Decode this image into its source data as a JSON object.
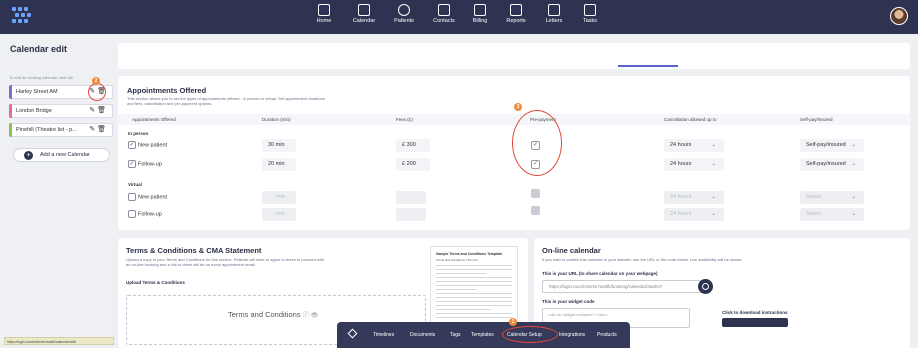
{
  "nav": {
    "items": [
      {
        "label": "Home",
        "icon": "home-icon"
      },
      {
        "label": "Calendar",
        "icon": "calendar-icon"
      },
      {
        "label": "Patients",
        "icon": "patients-icon"
      },
      {
        "label": "Contacts",
        "icon": "contacts-icon"
      },
      {
        "label": "Billing",
        "icon": "billing-icon"
      },
      {
        "label": "Reports",
        "icon": "reports-icon"
      },
      {
        "label": "Letters",
        "icon": "letters-icon"
      },
      {
        "label": "Tasks",
        "icon": "tasks-icon"
      }
    ]
  },
  "page_title": "Calendar edit",
  "sidebar": {
    "hint": "To edit an existing calendar click the",
    "calendars": [
      {
        "name": "Harley Street AM",
        "color": "#7b6fd6"
      },
      {
        "name": "London Bridge",
        "color": "#e36a9b"
      },
      {
        "name": "Pinehill (Theatre list - p...",
        "color": "#8bc34a"
      }
    ],
    "add_label": "Add a new Calendar"
  },
  "appointments": {
    "title": "Appointments Offered",
    "description": "This section allows you to set the types of appointments offered - in person or virtual. Set appointment durations and fees, cancellation and pre-payment options.",
    "headers": [
      "Appointments Offered",
      "Duration (min)",
      "Fees (£)",
      "Pre-payment",
      "Cancellation allowed up to",
      "Self-pay/insured"
    ],
    "groups": [
      {
        "label": "In person",
        "rows": [
          {
            "name": "New patient",
            "checked": true,
            "duration": "30 min",
            "fee": "£ 300",
            "prepay": true,
            "cancel": "24 hours",
            "pay": "Self-pay/insured"
          },
          {
            "name": "Follow-up",
            "checked": true,
            "duration": "20 min",
            "fee": "£ 200",
            "prepay": true,
            "cancel": "24 hours",
            "pay": "Self-pay/insured"
          }
        ]
      },
      {
        "label": "Virtual",
        "rows": [
          {
            "name": "New patient",
            "checked": false,
            "duration": "min",
            "fee": "",
            "prepay": false,
            "cancel": "24 hours",
            "pay": "Select"
          },
          {
            "name": "Follow-up",
            "checked": false,
            "duration": "min",
            "fee": "",
            "prepay": false,
            "cancel": "24 hours",
            "pay": "Select"
          }
        ]
      }
    ]
  },
  "terms": {
    "title": "Terms & Conditions & CMA Statement",
    "description": "Upload a copy of your Terms and Conditions for this service. Patients will have to agree to these to proceed with an on-line booking and a link to these will be on every appointment email.",
    "upload_label": "Upload Terms & Conditions",
    "drop_text": "Terms and Conditions",
    "doc_title": "Sample Terms and Conditions Template",
    "doc_subtitle": "Terms and Conditions (\"Terms\")"
  },
  "online": {
    "title": "On-line calendar",
    "description": "If you wish to publish this calendar in your website, use the URL or the code below. Live availability will be shown.",
    "url_label": "This is your URL (to share calendar on your webpage)",
    "url_value": "https://login.touchclients.health/booking/calendar/3ad047",
    "code_label": "This is your widget code",
    "code_value": "<div id=\"widget-container\"></div>",
    "download_label": "Click to download instructions"
  },
  "bottom_nav": {
    "items": [
      "Timelines",
      "Documents",
      "Tags",
      "Templates",
      "Calendar Setup",
      "Integrations",
      "Products"
    ],
    "active": "Calendar Setup"
  },
  "status_bar_url": "https://login.touchclients.health/calendar/edit",
  "annotations": [
    "1",
    "2",
    "3"
  ]
}
